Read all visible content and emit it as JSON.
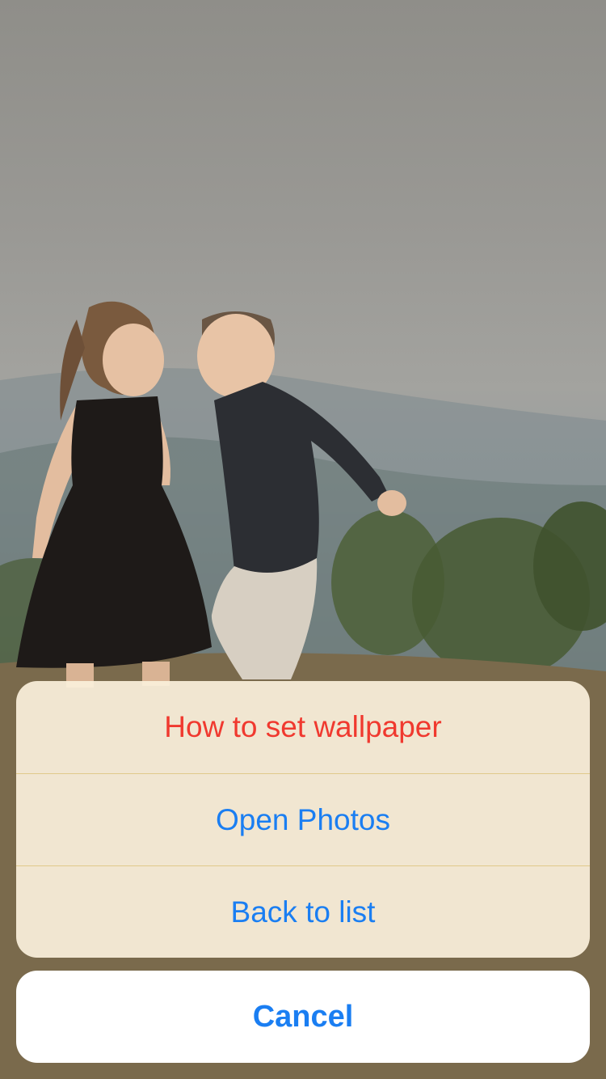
{
  "action_sheet": {
    "items": [
      {
        "label": "How to set wallpaper",
        "style": "destructive"
      },
      {
        "label": "Open Photos",
        "style": "default"
      },
      {
        "label": "Back to list",
        "style": "default"
      }
    ],
    "cancel_label": "Cancel"
  },
  "colors": {
    "accent": "#1a7ef2",
    "destructive": "#f0392f",
    "sheet_background": "#faf0dc",
    "separator": "#e0c98a"
  }
}
